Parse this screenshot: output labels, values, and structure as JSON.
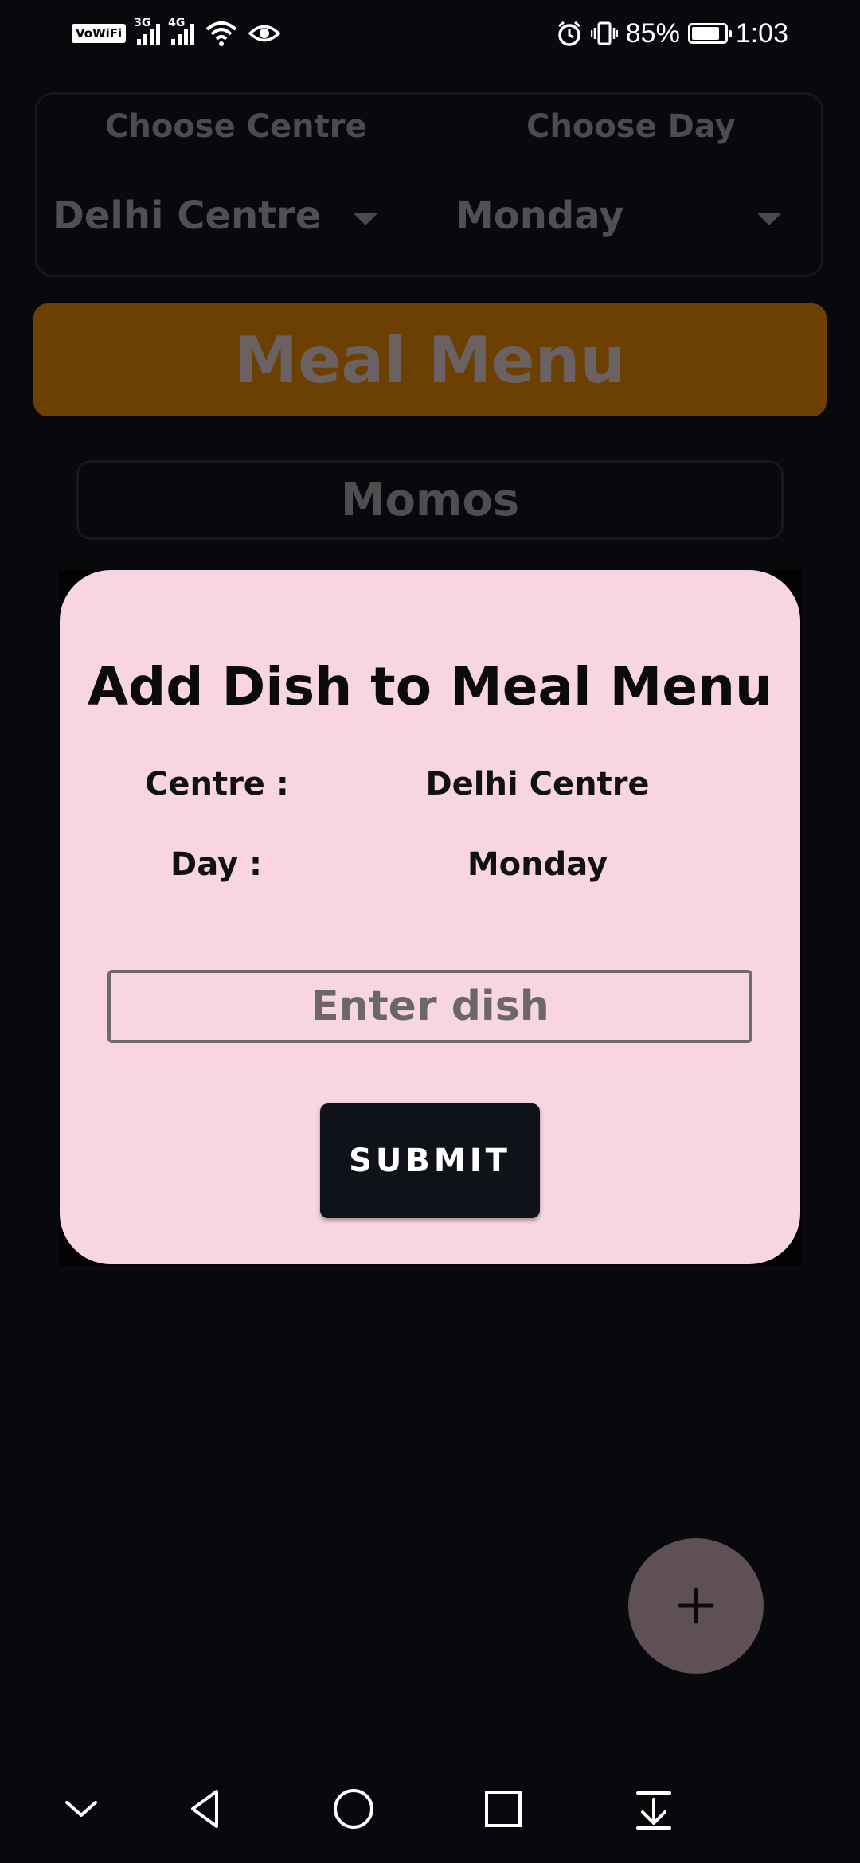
{
  "status_bar": {
    "vowifi_label": "VoWiFi",
    "sim1_network": "3G",
    "sim2_network": "4G",
    "battery_percent": "85%",
    "battery_level": 0.85,
    "time": "1:03"
  },
  "background": {
    "centre_label": "Choose Centre",
    "centre_value": "Delhi Centre",
    "day_label": "Choose Day",
    "day_value": "Monday",
    "banner_title": "Meal Menu",
    "dish_item": "Momos",
    "fab_icon": "plus-icon"
  },
  "dialog": {
    "title": "Add Dish to Meal Menu",
    "centre_label": "Centre :",
    "centre_value": "Delhi Centre",
    "day_label": "Day :",
    "day_value": "Monday",
    "dish_placeholder": "Enter dish",
    "dish_value": "",
    "submit_label": "SUBMIT"
  },
  "nav_bar": {
    "icons": [
      "chevron-down-icon",
      "back-icon",
      "home-icon",
      "recents-icon",
      "download-icon"
    ]
  },
  "colors": {
    "background": "#08090c",
    "banner": "#6b4002",
    "dialog": "#f7d5e2",
    "button": "#10121a",
    "fab": "#5e5054"
  }
}
